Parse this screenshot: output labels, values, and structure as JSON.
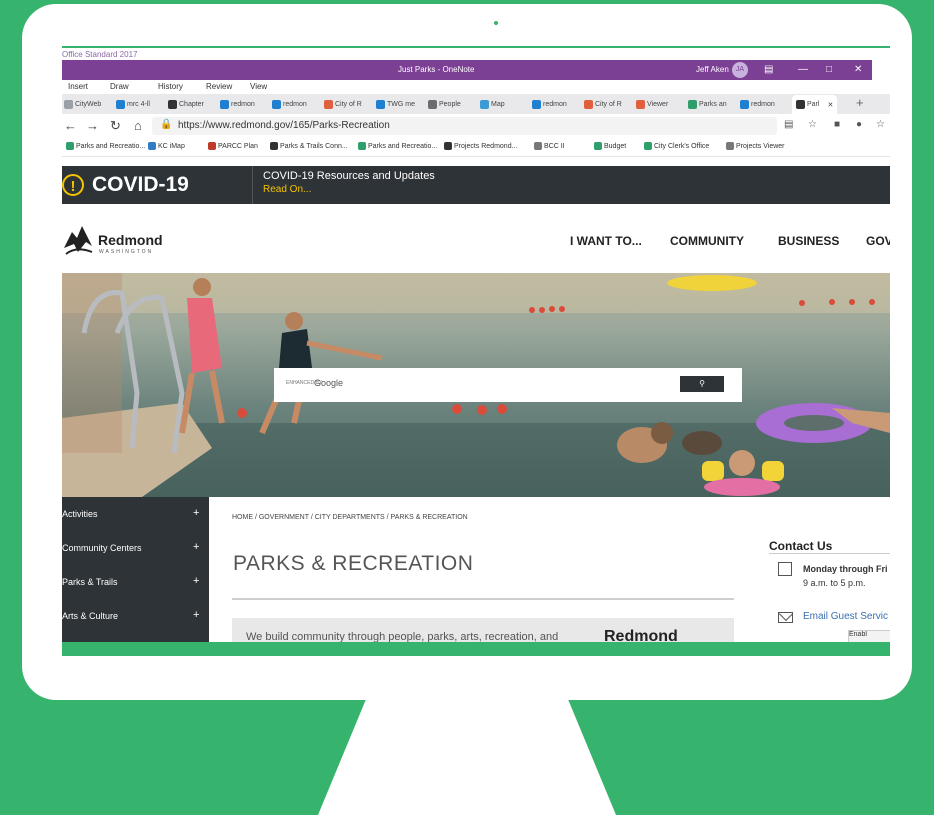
{
  "onenote": {
    "subtitle": "Office Standard 2017",
    "title": "Just Parks - OneNote",
    "user": "Jeff Aken",
    "user_initials": "JA",
    "menu": [
      "Insert",
      "Draw",
      "History",
      "Review",
      "View"
    ]
  },
  "browser": {
    "tabs": [
      {
        "label": "CityWeb",
        "icon": "page-icon",
        "color": "#9aa0a6"
      },
      {
        "label": "mrc 4-ll",
        "icon": "bing-icon",
        "color": "#1f7fd1"
      },
      {
        "label": "Chapter",
        "icon": "github-icon",
        "color": "#333333"
      },
      {
        "label": "redmon",
        "icon": "bing-icon",
        "color": "#1f7fd1"
      },
      {
        "label": "redmon",
        "icon": "bing-icon",
        "color": "#1f7fd1"
      },
      {
        "label": "City of R",
        "icon": "city-icon",
        "color": "#e0603d"
      },
      {
        "label": "TWG me",
        "icon": "bing-icon",
        "color": "#1f7fd1"
      },
      {
        "label": "People",
        "icon": "people-icon",
        "color": "#6d6d6d"
      },
      {
        "label": "Map",
        "icon": "map-icon",
        "color": "#3d9bd4"
      },
      {
        "label": "redmon",
        "icon": "bing-icon",
        "color": "#1f7fd1"
      },
      {
        "label": "City of R",
        "icon": "city-icon",
        "color": "#e0603d"
      },
      {
        "label": "Viewer",
        "icon": "city-icon",
        "color": "#e0603d"
      },
      {
        "label": "Parks an",
        "icon": "parks-icon",
        "color": "#2f9e6b"
      },
      {
        "label": "redmon",
        "icon": "bing-icon",
        "color": "#1f7fd1"
      },
      {
        "label": "Parl",
        "icon": "redmond-icon",
        "color": "#333333"
      }
    ],
    "url": "https://www.redmond.gov/165/Parks-Recreation",
    "bookmarks": [
      {
        "label": "Parks and Recreatio...",
        "color": "#2f9e6b"
      },
      {
        "label": "KC iMap",
        "color": "#2f7cc4"
      },
      {
        "label": "PARCC Plan",
        "color": "#c0392b"
      },
      {
        "label": "Parks & Trails Conn...",
        "color": "#333333"
      },
      {
        "label": "Parks and Recreatio...",
        "color": "#2f9e6b"
      },
      {
        "label": "Projects Redmond...",
        "color": "#333333"
      },
      {
        "label": "BCC II",
        "color": "#777777"
      },
      {
        "label": "Budget",
        "color": "#2f9e6b"
      },
      {
        "label": "City Clerk's Office",
        "color": "#2f9e6b"
      },
      {
        "label": "Projects Viewer",
        "color": "#777777"
      }
    ]
  },
  "site": {
    "covid": {
      "icon": "alert-icon",
      "title": "COVID-19",
      "line": "COVID-19 Resources and Updates",
      "link": "Read On..."
    },
    "logo": {
      "name": "Redmond",
      "sub": "WASHINGTON"
    },
    "nav": [
      "I WANT TO...",
      "COMMUNITY",
      "BUSINESS",
      "GOV"
    ],
    "search": {
      "label": "ENHANCED BY",
      "brand": "Google",
      "button_icon": "search-icon"
    },
    "sidebar": [
      "Activities",
      "Community Centers",
      "Parks & Trails",
      "Arts & Culture"
    ],
    "breadcrumb": "HOME / GOVERNMENT / CITY DEPARTMENTS / PARKS & RECREATION",
    "page_title": "PARKS & RECREATION",
    "intro": "We build community through people, parks, arts, recreation, and",
    "intro_logo": "Redmond",
    "contact": {
      "title": "Contact Us",
      "hours": "Monday through Fri",
      "time": "9 a.m. to 5 p.m.",
      "email": "Email Guest Servic",
      "enable": "Enabl"
    }
  },
  "colors": {
    "background": "#36b36c",
    "dark": "#2e3338",
    "onenote_purple": "#7b3f93",
    "covid_accent": "#f2c400"
  }
}
